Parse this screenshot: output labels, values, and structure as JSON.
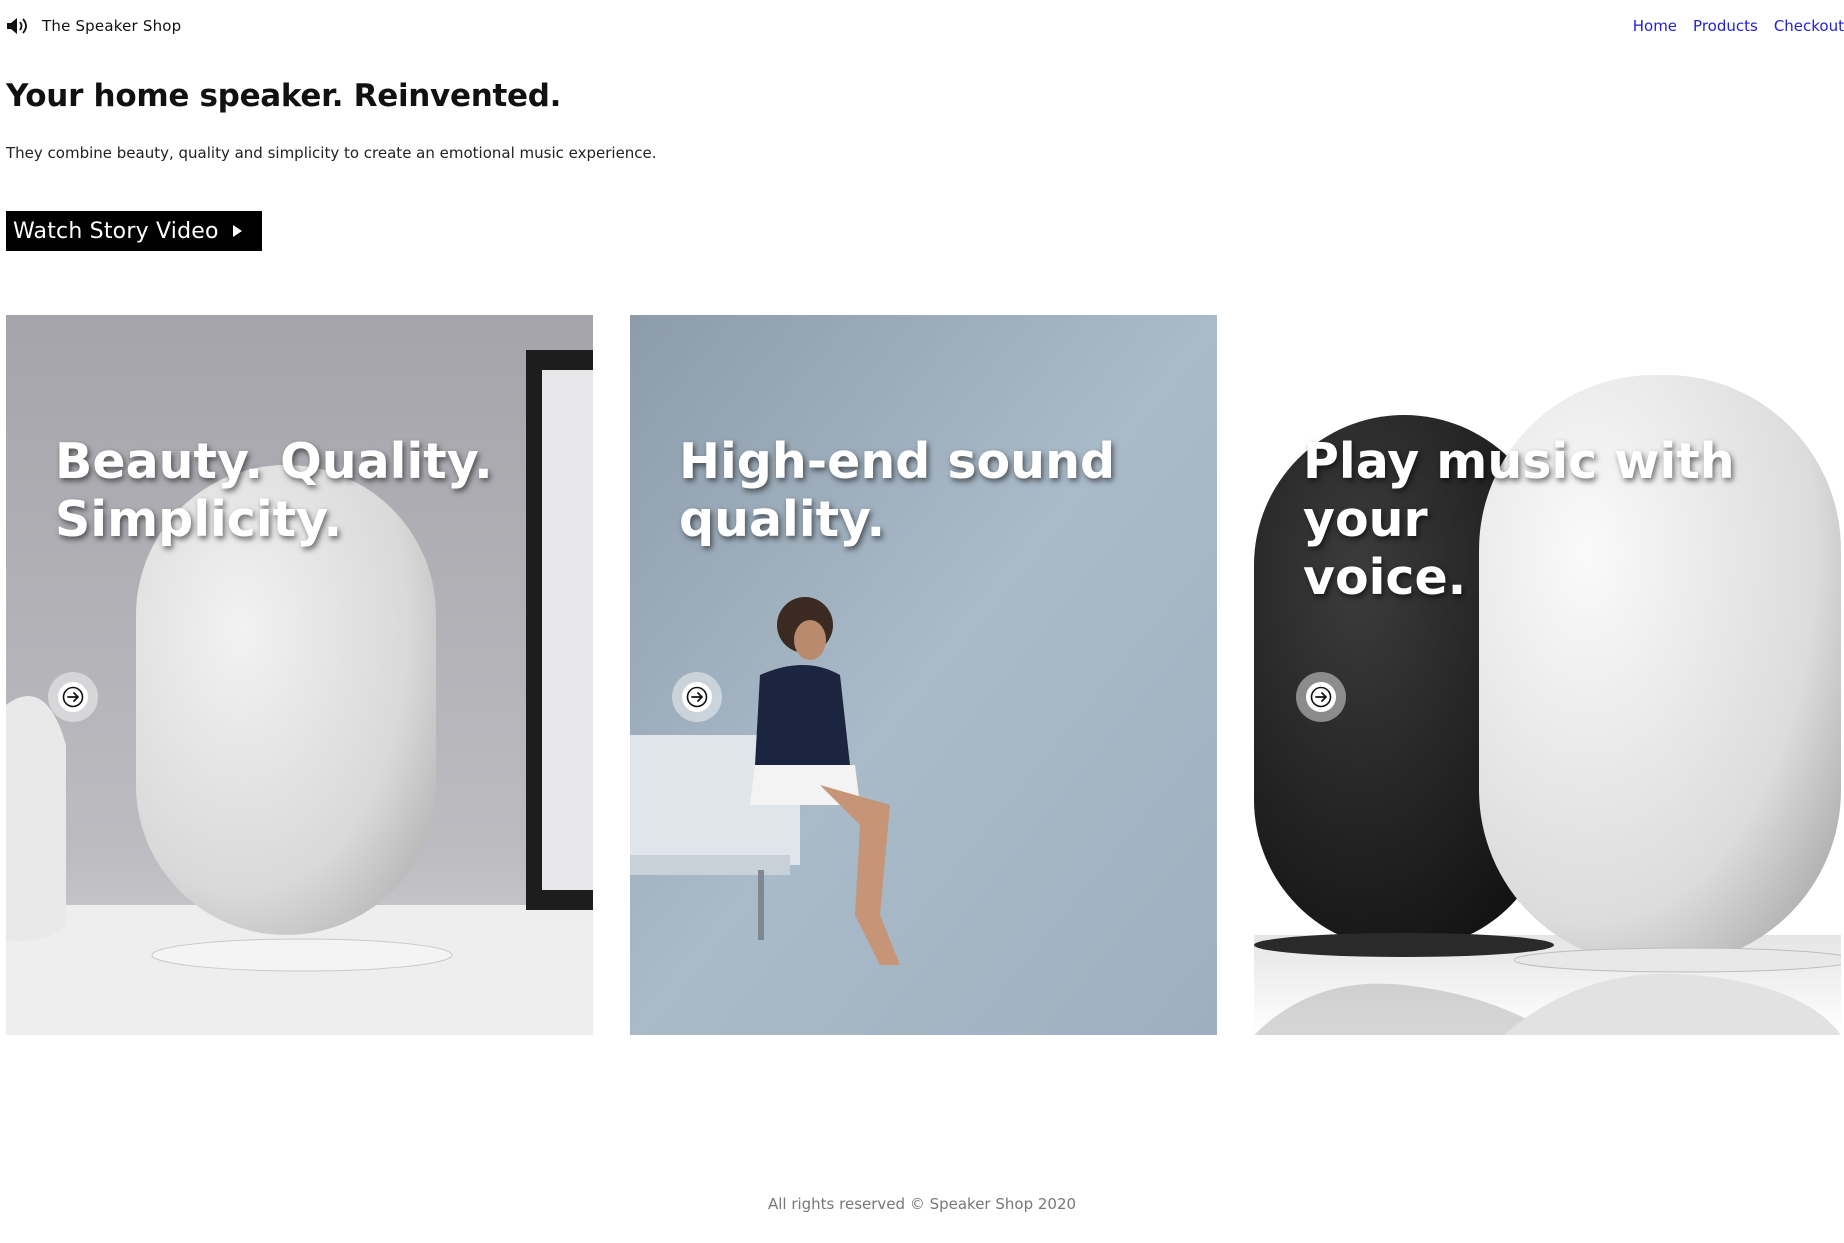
{
  "header": {
    "brand_name": "The Speaker Shop",
    "brand_icon": "speaker-icon",
    "nav": [
      {
        "label": "Home"
      },
      {
        "label": "Products"
      },
      {
        "label": "Checkout"
      }
    ]
  },
  "hero": {
    "title": "Your home speaker. Reinvented.",
    "subtitle": "They combine beauty, quality and simplicity to create an emotional music experience.",
    "cta_label": "Watch Story Video",
    "cta_icon": "play-icon"
  },
  "cards": [
    {
      "title_line1": "Beauty. Quality.",
      "title_line2": "Simplicity.",
      "icon": "arrow-right-icon"
    },
    {
      "title_line1": "High-end sound",
      "title_line2": "quality.",
      "icon": "arrow-right-icon"
    },
    {
      "title_line1": "Play music with your",
      "title_line2": "voice.",
      "icon": "arrow-right-icon"
    }
  ],
  "footer": {
    "text": "All rights reserved © Speaker Shop 2020"
  },
  "colors": {
    "link": "#1f1fd6",
    "cta_bg": "#000000",
    "footer_text": "#777777"
  }
}
